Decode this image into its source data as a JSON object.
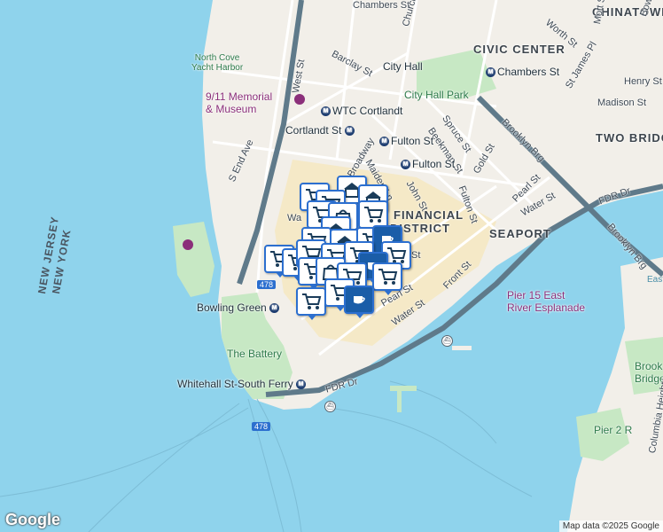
{
  "streets": {
    "chambers": "Chambers St",
    "church": "Church St",
    "barclay": "Barclay St",
    "west": "West St",
    "worth": "Worth St",
    "mott": "Mott St",
    "bowery": "Bowery",
    "henry": "Henry St",
    "madison": "Madison St",
    "st_james": "St James Pl",
    "spruce": "Spruce St",
    "beekman": "Beekman St",
    "gold": "Gold St",
    "brooklyn_brg": "Brooklyn Brg",
    "cortlandt": "Cortlandt St",
    "broadway": "Broadway",
    "maiden_ln": "Maiden Ln",
    "john": "John St",
    "fulton": "Fulton St",
    "pearl": "Pearl St",
    "water": "Water St",
    "front": "Front St",
    "fdr_dr": "FDR Dr",
    "s_end_ave": "S End Ave",
    "wall_frag": "Wa",
    "st_frag": "St",
    "i478": "478"
  },
  "districts": {
    "chinatown": "CHINATOWN",
    "civic_center": "CIVIC CENTER",
    "financial": "FINANCIAL",
    "district": "DISTRICT",
    "seaport": "SEAPORT",
    "two_bridges": "TWO BRIDGE",
    "east_frag": "East"
  },
  "pois": {
    "city_hall": "City Hall",
    "city_hall_park": "City Hall Park",
    "chambers_station": "Chambers St",
    "wtc_cortlandt": "WTC Cortlandt",
    "fulton_station_1": "Fulton St",
    "fulton_station_2": "Fulton St",
    "cortlandt_station": "Cortlandt St",
    "memorial_line1": "9/11 Memorial",
    "memorial_line2": "& Museum",
    "north_cove_line1": "North Cove",
    "north_cove_line2": "Yacht Harbor",
    "bowling_green": "Bowling Green",
    "the_battery": "The Battery",
    "whitehall": "Whitehall St-South Ferry",
    "pier15_line1": "Pier 15 East",
    "pier15_line2": "River Esplanade",
    "pier2": "Pier 2 R",
    "brooklyn_bridge_park_1": "Brook",
    "brooklyn_bridge_park_2": "Bridge",
    "columbia_heights": "Columbia Heights"
  },
  "states": {
    "new_jersey": "NEW JERSEY",
    "new_york": "NEW YORK"
  },
  "attribution": "Map data ©2025 Google",
  "logo": "Google",
  "marker_icons": [
    "cart-icon",
    "coffee-icon",
    "bag-icon",
    "shop-icon"
  ],
  "colors": {
    "water": "#8fd3ec",
    "land": "#f2efe9",
    "park": "#c7e8c4",
    "highway": "#5f7a8a",
    "pin_border": "#2c6fcf",
    "subway": "#1b3b6f"
  }
}
